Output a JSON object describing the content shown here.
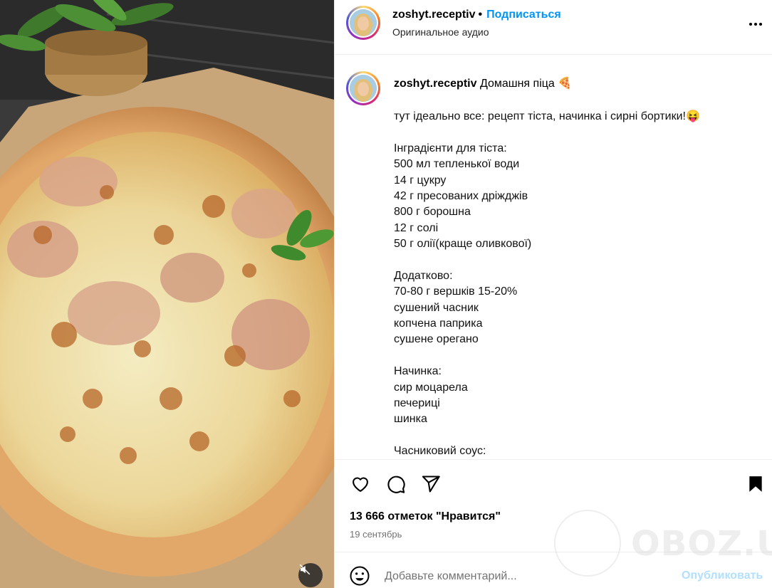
{
  "post": {
    "username": "zoshyt.receptiv",
    "separator": "•",
    "follow_label": "Подписаться",
    "audio_label": "Оригинальное аудио",
    "more_icon": "more-horizontal-icon",
    "mute_icon": "volume-muted-icon"
  },
  "caption": {
    "username": "zoshyt.receptiv",
    "title": "Домашня піца 🍕",
    "lines": [
      "тут ідеально все: рецепт тіста, начинка і сирні бортики!😝",
      "",
      "Інградієнти для тіста:",
      "500 мл тепленької води",
      "14 г цукру",
      "42 г пресованих дріжджів",
      "800 г борошна",
      "12 г солі",
      "50 г олії(краще оливкової)",
      "",
      "Додатково:",
      "70-80 г вершків 15-20%",
      "сушений часник",
      "копчена паприка",
      "сушене орегано",
      "",
      "Начинка:",
      "сир моцарела",
      "печериці",
      "шинка",
      "",
      "Часниковий соус:"
    ]
  },
  "actions": {
    "like_icon": "heart-icon",
    "comment_icon": "comment-icon",
    "share_icon": "share-icon",
    "save_icon": "bookmark-icon"
  },
  "likes_text": "13 666 отметок \"Нравится\"",
  "date_text": "19 сентябрь",
  "comment": {
    "placeholder": "Добавьте комментарий...",
    "post_label": "Опубликовать",
    "emoji_icon": "emoji-icon"
  },
  "watermark": "OBOZ.UA",
  "colors": {
    "accent": "#0095f6",
    "post_disabled": "#b2dffc",
    "muted_text": "#737373"
  }
}
